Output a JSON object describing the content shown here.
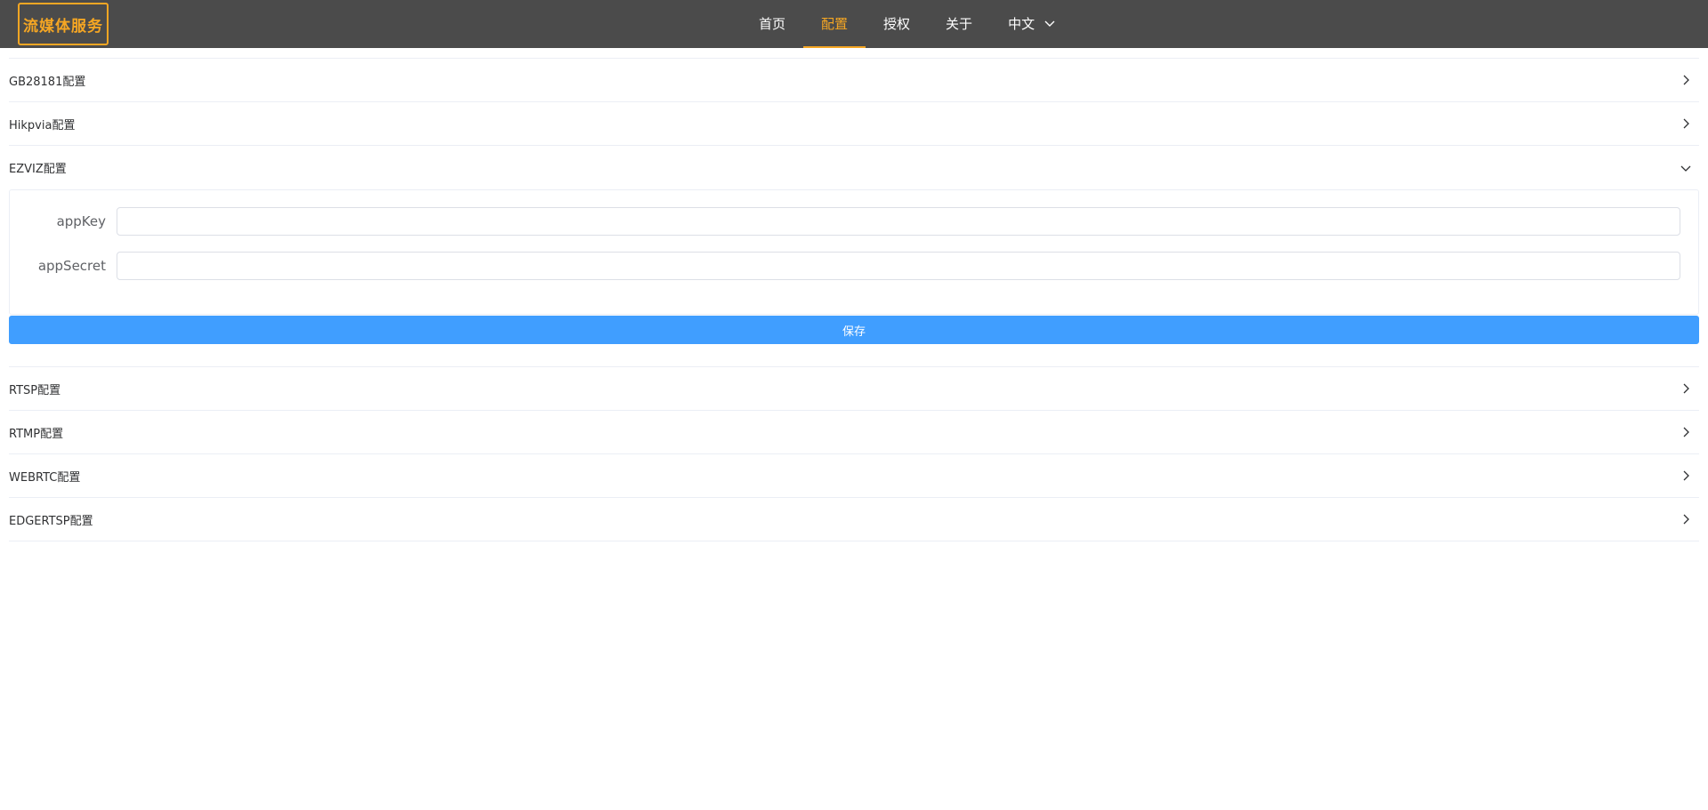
{
  "header": {
    "logo": "流媒体服务",
    "nav": [
      {
        "label": "首页",
        "active": false
      },
      {
        "label": "配置",
        "active": true
      },
      {
        "label": "授权",
        "active": false
      },
      {
        "label": "关于",
        "active": false
      },
      {
        "label": "中文",
        "active": false
      }
    ],
    "colors": {
      "background": "#4b4b4b",
      "accent": "#f5a623"
    }
  },
  "sections": [
    {
      "title": "GB28181配置",
      "expanded": false,
      "icon": "chevron-right-icon"
    },
    {
      "title": "Hikpvia配置",
      "expanded": false,
      "icon": "chevron-right-icon"
    },
    {
      "title": "EZVIZ配置",
      "expanded": true,
      "icon": "chevron-down-icon"
    },
    {
      "title": "RTSP配置",
      "expanded": false,
      "icon": "chevron-right-icon"
    },
    {
      "title": "RTMP配置",
      "expanded": false,
      "icon": "chevron-right-icon"
    },
    {
      "title": "WEBRTC配置",
      "expanded": false,
      "icon": "chevron-right-icon"
    },
    {
      "title": "EDGERTSP配置",
      "expanded": false,
      "icon": "chevron-right-icon"
    }
  ],
  "ezviz_form": {
    "fields": [
      {
        "label": "appKey",
        "value": "",
        "placeholder": ""
      },
      {
        "label": "appSecret",
        "value": "",
        "placeholder": ""
      }
    ],
    "save_label": "保存",
    "save_color": "#409eff"
  }
}
